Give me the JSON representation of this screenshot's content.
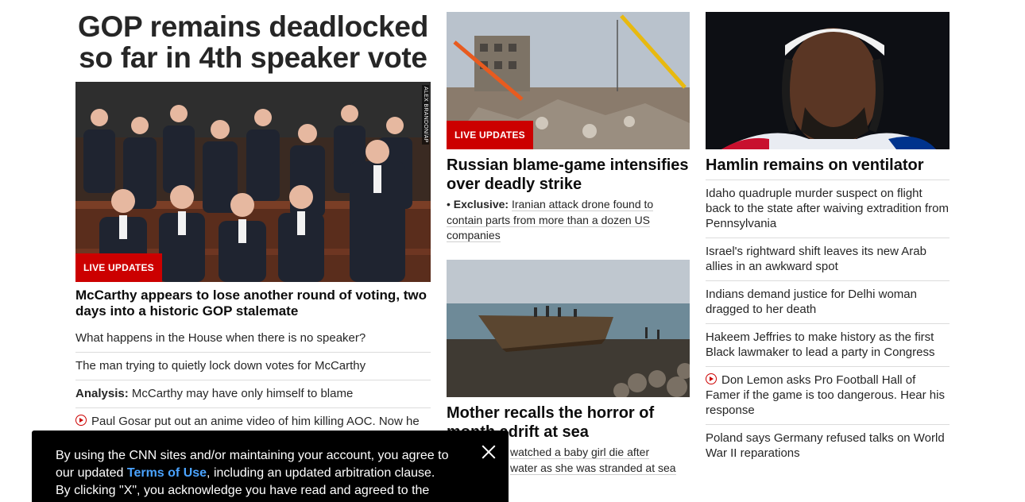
{
  "left": {
    "main_headline": "GOP remains deadlocked so far in 4th speaker vote",
    "photo_credit": "ALEX BRANDON/AP",
    "badge": "LIVE UPDATES",
    "story_headline": "McCarthy appears to lose another round of voting, two days into a historic GOP stalemate",
    "links": [
      {
        "text": "What happens in the House when there is no speaker?"
      },
      {
        "text": "The man trying to quietly lock down votes for McCarthy"
      },
      {
        "prefix": "Analysis:",
        "text": "McCarthy may have only himself to blame"
      },
      {
        "text": "Paul Gosar put out an anime video of him killing AOC. Now he",
        "video": true
      }
    ]
  },
  "middle": {
    "top_badge": "LIVE UPDATES",
    "top_headline": "Russian blame-game intensifies over deadly strike",
    "top_sub_prefix": "Exclusive:",
    "top_sub_text": "Iranian attack drone found to contain parts from more than a dozen US companies",
    "bottom_headline": "Mother recalls the horror of month adrift at sea",
    "bottom_sub_line1": "watched a baby girl die after",
    "bottom_sub_line2": "water as she was stranded at sea"
  },
  "right": {
    "headline": "Hamlin remains on ventilator",
    "links": [
      {
        "text": "Idaho quadruple murder suspect on flight back to the state after waiving extradition from Pennsylvania"
      },
      {
        "text": "Israel's rightward shift leaves its new Arab allies in an awkward spot"
      },
      {
        "text": "Indians demand justice for Delhi woman dragged to her death"
      },
      {
        "text": "Hakeem Jeffries to make history as the first Black lawmaker to lead a party in Congress"
      },
      {
        "text": "Don Lemon asks Pro Football Hall of Famer if the game is too dangerous. Hear his response",
        "video": true
      },
      {
        "text": "Poland says Germany refused talks on World War II reparations"
      }
    ]
  },
  "consent": {
    "line1": "By using the CNN sites and/or maintaining your account, you agree to",
    "line2_before": "our updated",
    "terms_link": "Terms of Use",
    "line2_after": ", including an updated arbitration clause.",
    "line3": "By clicking \"X\", you acknowledge you have read and agreed to the"
  },
  "colors": {
    "accent": "#cc0000",
    "link_blue": "#4aa3ff",
    "text": "#0c0c0c"
  }
}
